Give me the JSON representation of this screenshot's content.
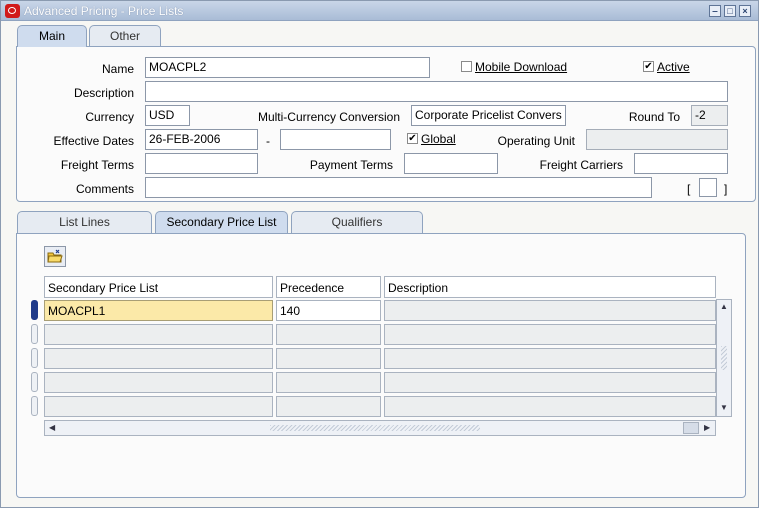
{
  "window": {
    "title": "Advanced Pricing - Price Lists",
    "controls": {
      "minimize": "‒",
      "maximize": "□",
      "close": "×"
    }
  },
  "top_tabs": [
    {
      "label": "Main",
      "active": true
    },
    {
      "label": "Other",
      "active": false
    }
  ],
  "header": {
    "name_label": "Name",
    "name_value": "MOACPL2",
    "mobile_download_label": "Mobile Download",
    "mobile_download_checked": false,
    "active_label": "Active",
    "active_checked": true,
    "description_label": "Description",
    "description_value": "",
    "currency_label": "Currency",
    "currency_value": "USD",
    "multi_currency_label": "Multi-Currency Conversion",
    "multi_currency_value": "Corporate Pricelist Convers",
    "round_to_label": "Round To",
    "round_to_value": "-2",
    "effective_dates_label": "Effective Dates",
    "effective_from": "26-FEB-2006",
    "effective_dash": "-",
    "effective_to": "",
    "global_label": "Global",
    "global_checked": true,
    "operating_unit_label": "Operating Unit",
    "operating_unit_value": "",
    "freight_terms_label": "Freight Terms",
    "freight_terms_value": "",
    "payment_terms_label": "Payment Terms",
    "payment_terms_value": "",
    "freight_carriers_label": "Freight Carriers",
    "freight_carriers_value": "",
    "comments_label": "Comments",
    "comments_value": "",
    "dff_open": "[",
    "dff_close": "]"
  },
  "bottom_tabs": [
    {
      "label": "List Lines",
      "active": false
    },
    {
      "label": "Secondary Price List",
      "active": true
    },
    {
      "label": "Qualifiers",
      "active": false
    }
  ],
  "grid": {
    "columns": [
      "Secondary Price List",
      "Precedence",
      "Description"
    ],
    "rows": [
      [
        "MOACPL1",
        "140",
        ""
      ],
      [
        "",
        "",
        ""
      ],
      [
        "",
        "",
        ""
      ],
      [
        "",
        "",
        ""
      ],
      [
        "",
        "",
        ""
      ]
    ]
  },
  "colors": {
    "title_bar": "#a9bcd6",
    "current_cell": "#fbe9a8",
    "current_row_marker": "#1f3a8a"
  }
}
